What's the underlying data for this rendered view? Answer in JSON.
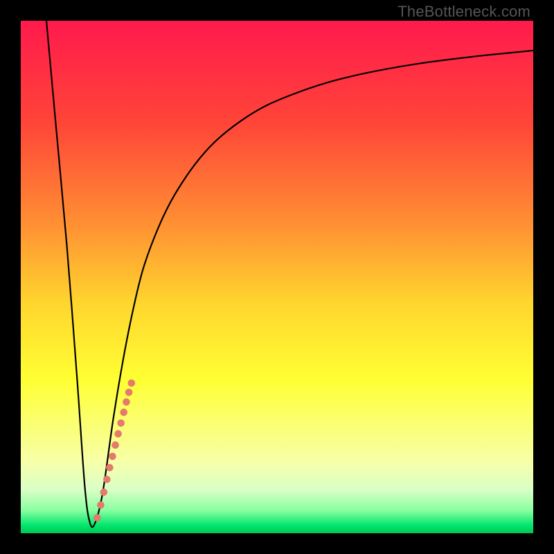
{
  "watermark": "TheBottleneck.com",
  "chart_data": {
    "type": "line",
    "title": "",
    "xlabel": "",
    "ylabel": "",
    "xlim": [
      0,
      100
    ],
    "ylim": [
      0,
      100
    ],
    "grid": false,
    "legend": false,
    "background_gradient_stops": [
      {
        "pos": 0.0,
        "color": "#ff1a4d"
      },
      {
        "pos": 0.2,
        "color": "#ff4538"
      },
      {
        "pos": 0.4,
        "color": "#ff9133"
      },
      {
        "pos": 0.55,
        "color": "#ffd52e"
      },
      {
        "pos": 0.7,
        "color": "#ffff33"
      },
      {
        "pos": 0.86,
        "color": "#f7ffa8"
      },
      {
        "pos": 0.915,
        "color": "#d9ffc6"
      },
      {
        "pos": 0.955,
        "color": "#8affa0"
      },
      {
        "pos": 0.985,
        "color": "#00e66e"
      },
      {
        "pos": 1.0,
        "color": "#00c755"
      }
    ],
    "series": [
      {
        "name": "bottleneck-curve",
        "color": "#000000",
        "stroke_width": 2.2,
        "x": [
          5,
          7,
          9,
          11,
          12.5,
          13.5,
          14.5,
          16,
          18,
          20,
          22,
          24,
          27,
          30,
          34,
          38,
          43,
          48,
          54,
          60,
          66,
          72,
          78,
          84,
          90,
          96,
          100
        ],
        "y": [
          100,
          78,
          56,
          30,
          9,
          2,
          2,
          8,
          22,
          34,
          44,
          52,
          60,
          66,
          72,
          76.5,
          80.5,
          83.5,
          86,
          88,
          89.5,
          90.7,
          91.7,
          92.5,
          93.2,
          93.8,
          94.2
        ]
      }
    ],
    "highlight": {
      "name": "highlight-segment",
      "color": "#e47b6a",
      "dot_radius": 5.3,
      "points_xy": [
        [
          14.9,
          3.0
        ],
        [
          15.6,
          5.5
        ],
        [
          16.2,
          8.0
        ],
        [
          16.8,
          10.5
        ],
        [
          17.35,
          12.8
        ],
        [
          17.9,
          15.0
        ],
        [
          18.45,
          17.2
        ],
        [
          19.0,
          19.4
        ],
        [
          19.55,
          21.5
        ],
        [
          20.1,
          23.6
        ],
        [
          20.6,
          25.6
        ],
        [
          21.1,
          27.5
        ],
        [
          21.6,
          29.3
        ]
      ]
    }
  }
}
